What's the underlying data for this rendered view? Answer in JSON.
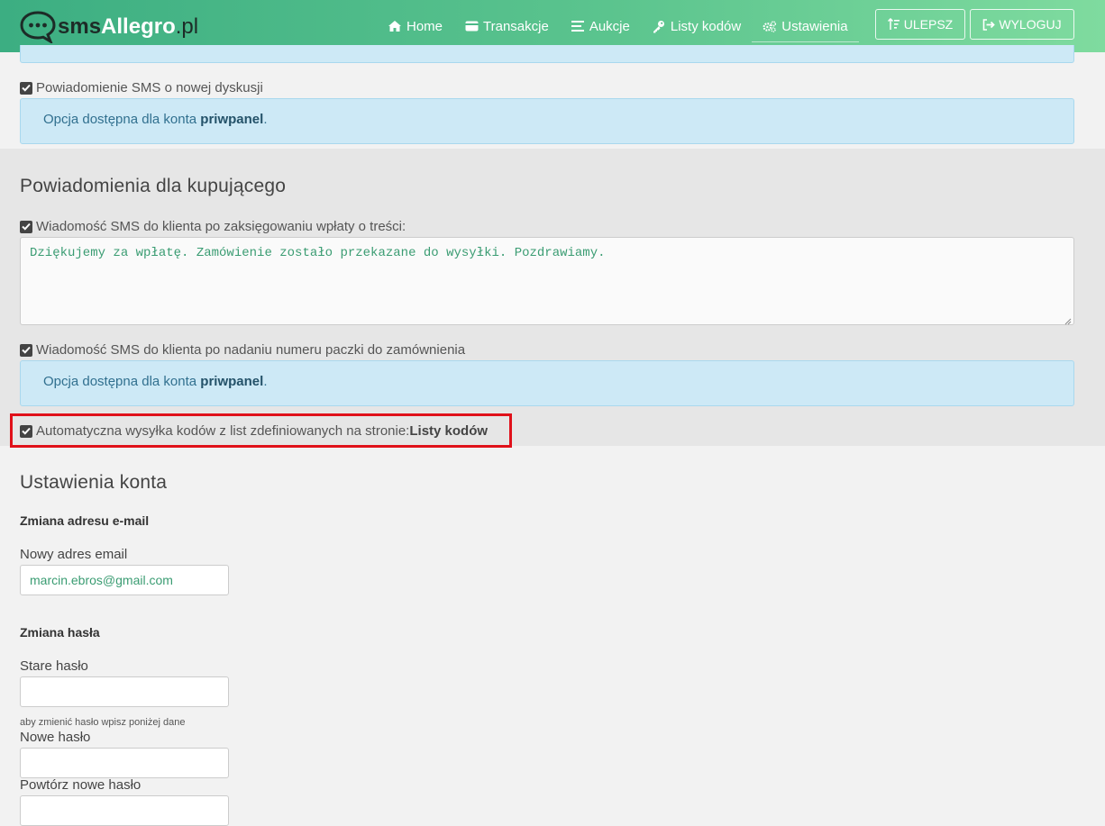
{
  "navbar": {
    "logo": {
      "sms": "sms",
      "allegro": "Allegro",
      "pl": ".pl"
    },
    "items": [
      {
        "label": "Home",
        "icon": "home-icon"
      },
      {
        "label": "Transakcje",
        "icon": "credit-card-icon"
      },
      {
        "label": "Aukcje",
        "icon": "list-icon"
      },
      {
        "label": "Listy kodów",
        "icon": "key-icon"
      },
      {
        "label": "Ustawienia",
        "icon": "cogs-icon",
        "active": true
      }
    ],
    "upgrade_label": "ULEPSZ",
    "logout_label": "WYLOGUJ"
  },
  "top": {
    "discussion_check": "Powiadomienie SMS o nowej dyskusji",
    "info_prefix": "Opcja dostępna dla konta ",
    "info_plan": "priwpanel",
    "info_suffix": "."
  },
  "buyer": {
    "heading": "Powiadomienia dla kupującego",
    "payment_check": "Wiadomość SMS do klienta po zaksięgowaniu wpłaty o treści:",
    "payment_text": "Dziękujemy za wpłatę. Zamówienie zostało przekazane do wysyłki. Pozdrawiamy.",
    "parcel_check": "Wiadomość SMS do klienta po nadaniu numeru paczki do zamównienia",
    "info_prefix": "Opcja dostępna dla konta ",
    "info_plan": "priwpanel",
    "info_suffix": ".",
    "auto_check": "Automatyczna wysyłka kodów z list zdefiniowanych na stronie: ",
    "auto_link": "Listy kodów"
  },
  "account": {
    "heading": "Ustawienia konta",
    "email_heading": "Zmiana adresu e-mail",
    "email_label": "Nowy adres email",
    "email_value": "marcin.ebros@gmail.com",
    "password_heading": "Zmiana hasła",
    "old_password_label": "Stare hasło",
    "help_text": "aby zmienić hasło wpisz poniżej dane",
    "new_password_label": "Nowe hasło",
    "repeat_password_label": "Powtórz nowe hasło"
  },
  "colors": {
    "nav_gradient_start": "#3cae82",
    "nav_gradient_end": "#7fdb9f",
    "info_bg": "#cde9f6",
    "highlight": "#e0111a",
    "text_green": "#3a9c72"
  }
}
